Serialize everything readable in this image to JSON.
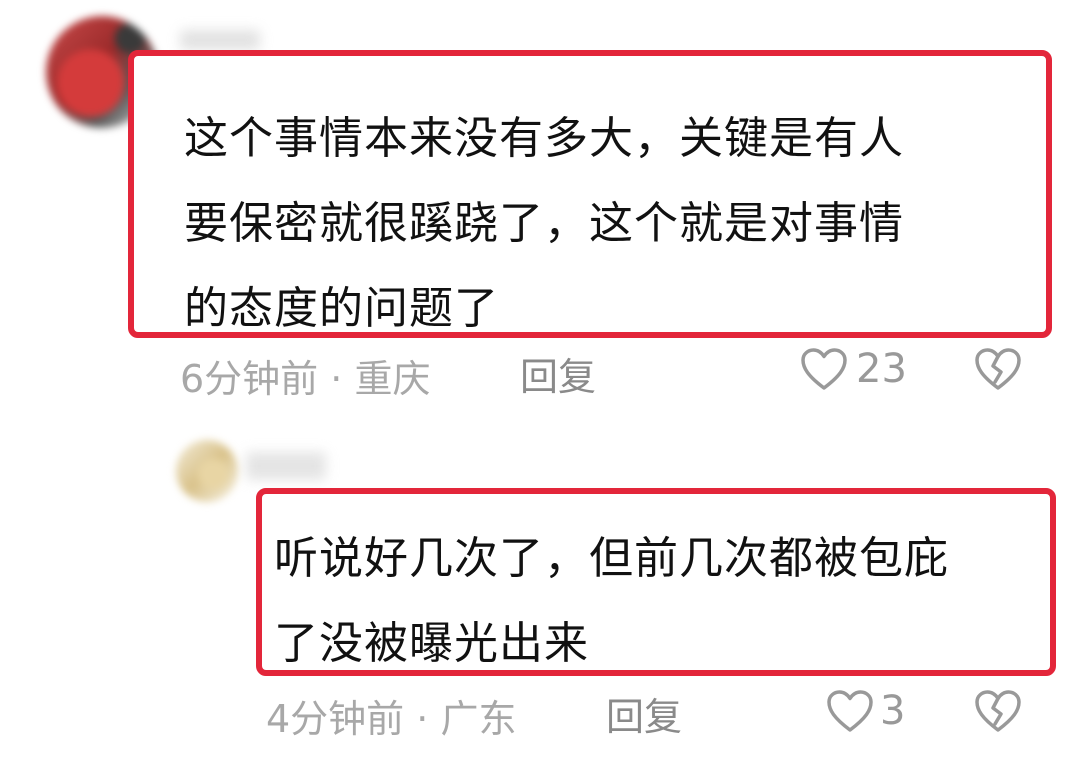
{
  "comments": [
    {
      "text_lines": [
        "这个事情本来没有多大，关键是有人",
        "要保密就很蹊跷了，这个就是对事情",
        "的态度的问题了"
      ],
      "time": "6分钟前",
      "location": "重庆",
      "reply_label": "回复",
      "likes": "23"
    },
    {
      "text_lines": [
        "听说好几次了，但前几次都被包庇",
        "了没被曝光出来"
      ],
      "time": "4分钟前",
      "location": "广东",
      "reply_label": "回复",
      "likes": "3"
    }
  ],
  "separator": "·",
  "colors": {
    "highlight_border": "#e3263a",
    "meta_text": "#a8a8a8",
    "body_text": "#111111"
  },
  "icons": {
    "like": "heart-outline-icon",
    "dislike": "broken-heart-icon"
  }
}
